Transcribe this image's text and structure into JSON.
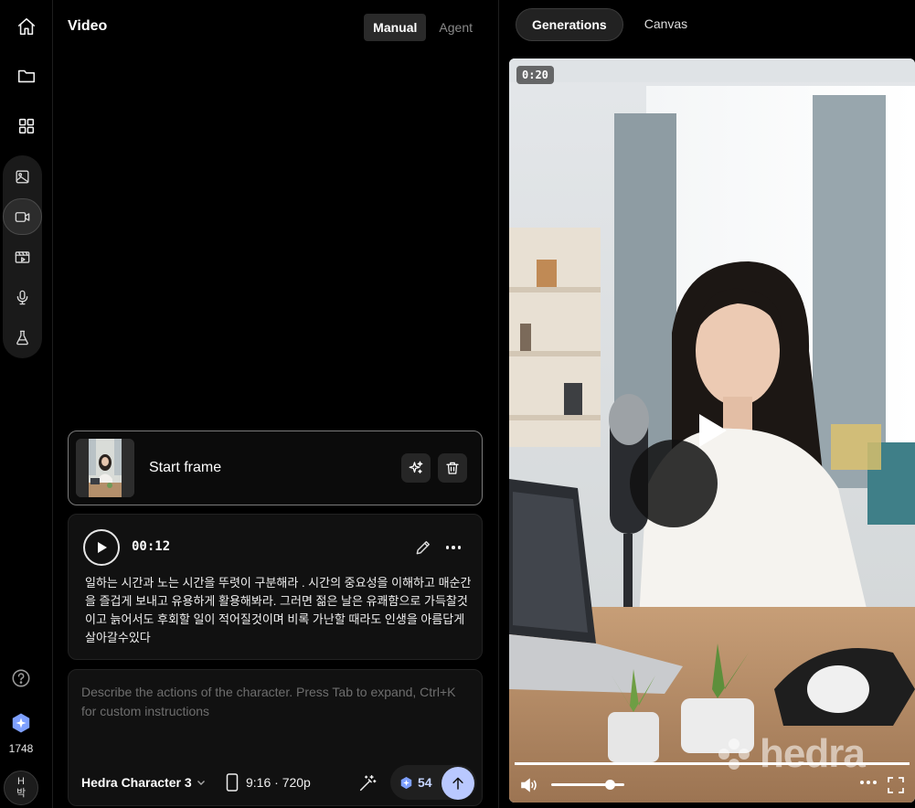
{
  "sidebar": {
    "nav_icons": [
      "home-icon",
      "folder-icon",
      "grid-icon"
    ],
    "tool_icons": [
      "image-icon",
      "video-icon",
      "storyboard-icon",
      "microphone-icon",
      "flask-icon"
    ],
    "active_tool": "video-icon",
    "help_icon": "help-icon",
    "credits": "1748",
    "avatar_initial": "H",
    "avatar_name": "박"
  },
  "panel": {
    "title": "Video",
    "mode_tabs": [
      {
        "label": "Manual",
        "active": true
      },
      {
        "label": "Agent",
        "active": false
      }
    ],
    "start_frame": {
      "label": "Start frame"
    },
    "audio": {
      "time": "00:12",
      "script": "일하는 시간과 노는 시간을 뚜렷이 구분해라 . 시간의 중요성을 이해하고 매순간을 즐겁게 보내고 유용하게 활용해봐라. 그러면 젊은 날은 유쾌함으로 가득찰것이고 늙어서도 후회할 일이 적어질것이며 비록 가난할 때라도 인생을 아름답게 살아갈수있다"
    },
    "prompt": {
      "placeholder": "Describe the actions of the character. Press Tab to expand, Ctrl+K for custom instructions",
      "value": "",
      "model": "Hedra Character 3",
      "aspect": "9:16 · 720p",
      "cost": "54"
    }
  },
  "right": {
    "tabs": [
      {
        "label": "Generations",
        "active": true
      },
      {
        "label": "Canvas",
        "active": false
      }
    ],
    "video": {
      "duration": "0:20",
      "watermark": "hedra",
      "progress": 1.0,
      "volume": 0.8
    }
  },
  "colors": {
    "accent": "#b9c8ff",
    "credit_blue": "#7ea0ff",
    "background": "#000000",
    "card": "#111111"
  }
}
